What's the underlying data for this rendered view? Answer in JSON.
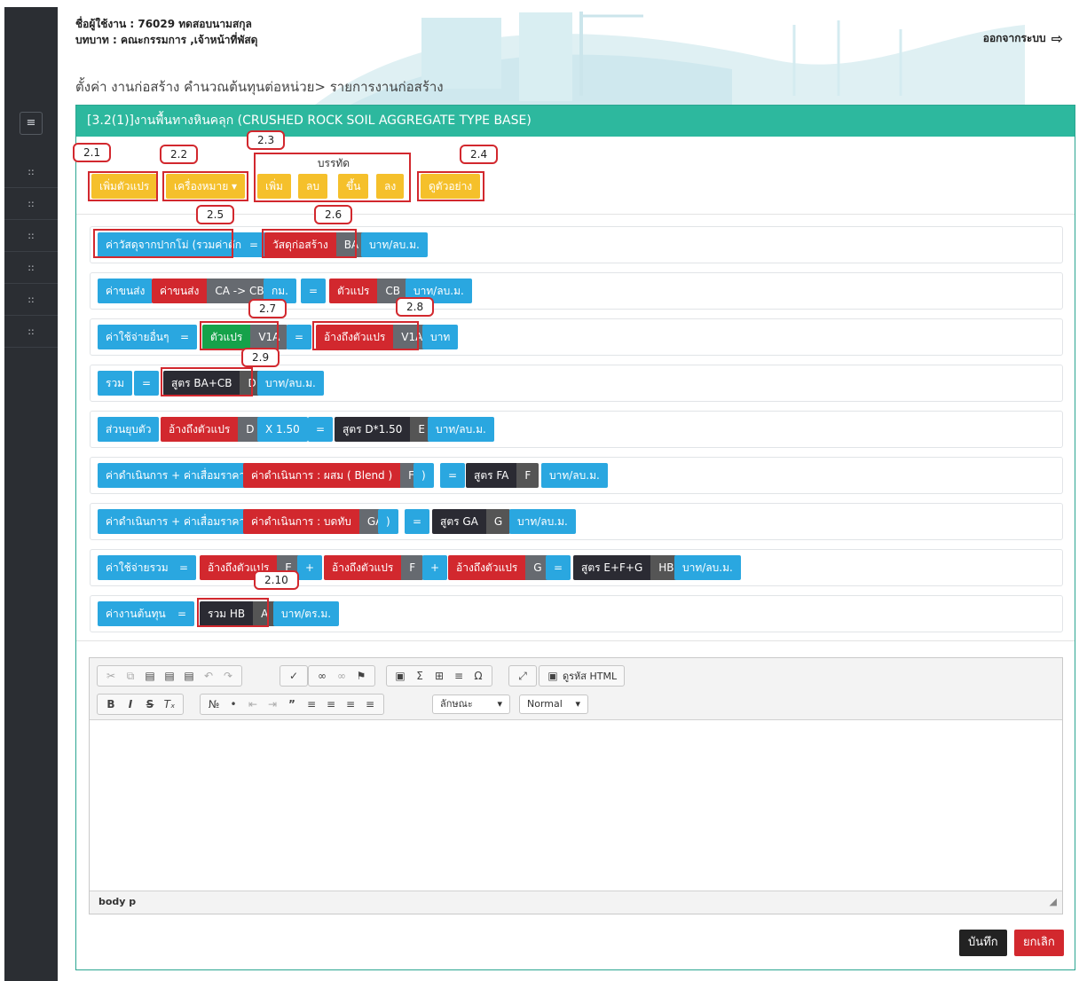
{
  "header": {
    "user_line": "ชื่อผู้ใช้งาน : 76029 ทดสอบนามสกุล",
    "role_line": "บทบาท : คณะกรรมการ ,เจ้าหน้าที่พัสดุ",
    "logout": "ออกจากระบบ",
    "breadcrumb": "ตั้งค่า งานก่อสร้าง คำนวณต้นทุนต่อหน่วย> รายการงานก่อสร้าง"
  },
  "sidebar": {
    "toggle_icon": "menu-icon",
    "items": [
      "::",
      "::",
      "::",
      "::",
      "::",
      "::"
    ]
  },
  "panel": {
    "title": "[3.2(1)]งานพื้นทางหินคลุก (CRUSHED ROCK SOIL AGGREGATE TYPE BASE)"
  },
  "toolbar": {
    "add_var": "เพิ่มตัวแปร",
    "symbols": "เครื่องหมาย ▾",
    "row_label": "บรรทัด",
    "row_add": "เพิ่ม",
    "row_del": "ลบ",
    "row_up": "ขึ้น",
    "row_down": "ลง",
    "preview": "ดูตัวอย่าง"
  },
  "callouts": [
    "2.1",
    "2.2",
    "2.3",
    "2.4",
    "2.5",
    "2.6",
    "2.7",
    "2.8",
    "2.9",
    "2.10"
  ],
  "rows": {
    "r1": {
      "a": "ค่าวัสดุจากปากโม่ (รวมค่าตัก)",
      "eq": "=",
      "b": "วัสดุก่อสร้าง",
      "b2": "BA",
      "c": "บาท/ลบ.ม."
    },
    "r2": {
      "a": "ค่าขนส่ง",
      "b": "ค่าขนส่ง",
      "b2": "CA -> CB",
      "c": "กม.",
      "eq": "=",
      "d": "ตัวแปร",
      "d2": "CB",
      "e": "บาท/ลบ.ม."
    },
    "r3": {
      "a": "ค่าใช้จ่ายอื่นๆ",
      "eq": "=",
      "b": "ตัวแปร",
      "b2": "V1A",
      "eq2": "=",
      "c": "อ้างถึงตัวแปร",
      "c2": "V1A",
      "d": "บาท"
    },
    "r4": {
      "a": "รวม",
      "eq": "=",
      "b": "สูตร BA+CB",
      "b2": "D",
      "c": "บาท/ลบ.ม."
    },
    "r5": {
      "a": "ส่วนยุบตัว",
      "b": "อ้างถึงตัวแปร",
      "b2": "D",
      "c": "X 1.50",
      "eq": "=",
      "d": "สูตร D*1.50",
      "d2": "E",
      "e": "บาท/ลบ.ม."
    },
    "r6": {
      "a": "ค่าดำเนินการ + ค่าเสื่อมราคา (",
      "b": "ค่าดำเนินการ : ผสม ( Blend )",
      "b2": "FA",
      "c": ")",
      "eq": "=",
      "d": "สูตร FA",
      "d2": "F",
      "e": "บาท/ลบ.ม."
    },
    "r7": {
      "a": "ค่าดำเนินการ + ค่าเสื่อมราคา (",
      "b": "ค่าดำเนินการ : บดทับ",
      "b2": "GA",
      "c": ")",
      "eq": "=",
      "d": "สูตร GA",
      "d2": "G",
      "e": "บาท/ลบ.ม."
    },
    "r8": {
      "a": "ค่าใช้จ่ายรวม",
      "eq": "=",
      "b": "อ้างถึงตัวแปร",
      "b2": "E",
      "p1": "+",
      "c": "อ้างถึงตัวแปร",
      "c2": "F",
      "p2": "+",
      "d": "อ้างถึงตัวแปร",
      "d2": "G",
      "eq2": "=",
      "e": "สูตร E+F+G",
      "e2": "HB",
      "f": "บาท/ลบ.ม."
    },
    "r9": {
      "a": "ค่างานต้นทุน",
      "eq": "=",
      "b": "รวม HB",
      "b2": "A",
      "c": "บาท/ตร.ม."
    }
  },
  "editor": {
    "source_label": "ดูรหัส HTML",
    "font_combo": "ลักษณะ",
    "size_combo": "Normal",
    "path": "body  p"
  },
  "actions": {
    "save": "บันทึก",
    "cancel": "ยกเลิก"
  },
  "colors": {
    "teal_header": "#2db89e",
    "yellow": "#f5c02b",
    "blue": "#2aa7e0",
    "red": "#d2282e",
    "green": "#15a24a",
    "dark": "#2b2b33"
  }
}
